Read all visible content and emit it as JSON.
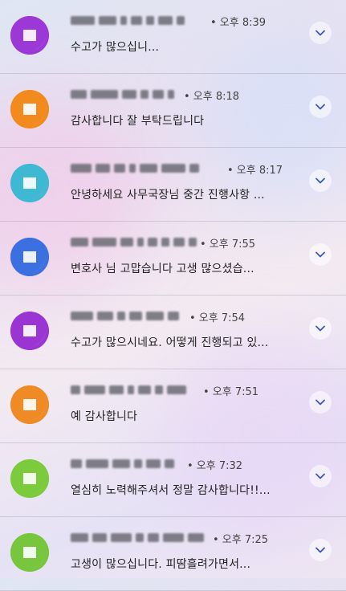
{
  "notifications": [
    {
      "avatar_color": "#9b38d6",
      "time": "• 오후 8:39",
      "message": "수고가 많으십니..."
    },
    {
      "avatar_color": "#f28a1e",
      "time": "• 오후 8:18",
      "message": "감사합니다  잘 부탁드립니다"
    },
    {
      "avatar_color": "#3fb8d4",
      "time": "• 오후 8:17",
      "message": "안녕하세요 사무국장님 중간 진행사항 ..."
    },
    {
      "avatar_color": "#3c6fe0",
      "time": "• 오후 7:55",
      "message": "변호사 님  고맙습니다  고생 많으셨습..."
    },
    {
      "avatar_color": "#9a34d3",
      "time": "• 오후 7:54",
      "message": "수고가 많으시네요. 어떻게 진행되고 있..."
    },
    {
      "avatar_color": "#f08a24",
      "time": "• 오후 7:51",
      "message": "예 감사합니다"
    },
    {
      "avatar_color": "#7ccb3c",
      "time": "• 오후 7:32",
      "message": "열심히 노력해주셔서 정말 감사합니다!!..."
    },
    {
      "avatar_color": "#77c63e",
      "time": "• 오후 7:25",
      "message": "고생이 많으십니다. 피땀흘려가면서..."
    }
  ],
  "icons": {
    "expand": "chevron-down-icon",
    "avatar": "app-avatar-icon"
  }
}
